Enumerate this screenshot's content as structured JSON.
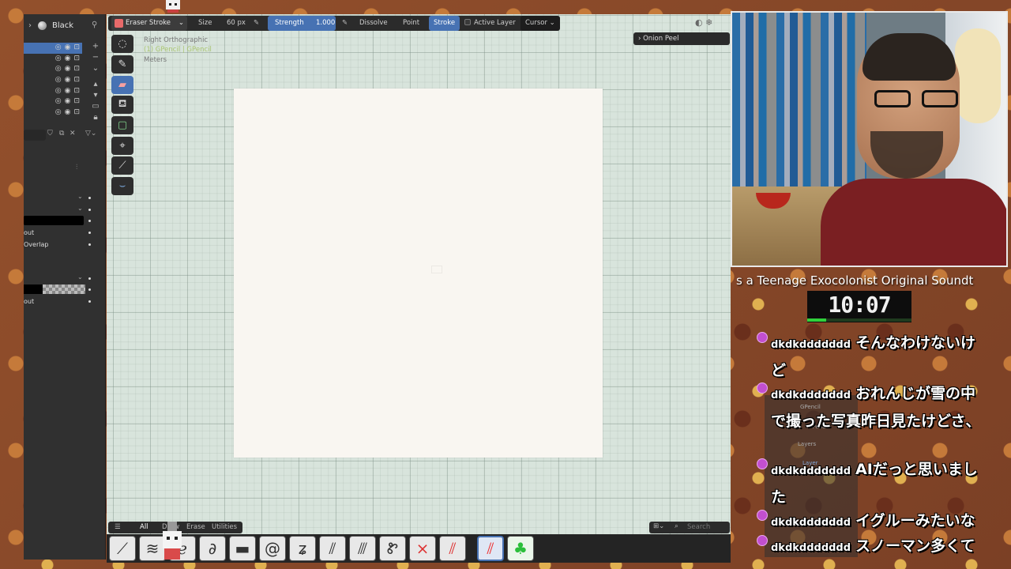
{
  "left_panel": {
    "title": "Black",
    "labels": {
      "out1": "out",
      "overlap": "Overlap",
      "out2": "out"
    },
    "layer_rows": 7
  },
  "viewport": {
    "view_name": "Right Orthographic",
    "object_name": "(1) GPencil | GPencil",
    "units": "Meters"
  },
  "toolbar": {
    "tool_name": "Eraser Stroke",
    "size_label": "Size",
    "size_value": "60 px",
    "strength_label": "Strength",
    "strength_value": "1.000",
    "dissolve": "Dissolve",
    "point": "Point",
    "stroke": "Stroke",
    "active_layer": "Active Layer",
    "cursor": "Cursor"
  },
  "onion_peel": "Onion Peel",
  "shelf": {
    "tabs": {
      "all": "All",
      "draw": "Draw",
      "erase": "Erase",
      "utilities": "Utilities"
    },
    "search_placeholder": "Search"
  },
  "ghost_panel": {
    "gpencil1": "GPencil",
    "gpencil2": "GPencil",
    "layers": "Layers",
    "layer": "Layer"
  },
  "overlay": {
    "song_ticker": "s a Teenage Exocolonist Original Soundt",
    "timer": "10:07",
    "timer_progress": 0.18,
    "accent_green": "#2fd13b"
  },
  "chat": [
    {
      "user": "dkdkddddddd",
      "message": "そんなわけないけど"
    },
    {
      "user": "dkdkddddddd",
      "message": "おれんじが雪の中で撮った写真昨日見たけどさ、"
    },
    {
      "user": "dkdkddddddd",
      "message": "AIだっと思いました"
    },
    {
      "user": "dkdkddddddd",
      "message": "イグルーみたいな"
    },
    {
      "user": "dkdkddddddd",
      "message": "スノーマン多くて"
    }
  ],
  "colors": {
    "accent_blue": "#4772b3",
    "panel": "#303030",
    "chat_badge": "#c24fcf"
  }
}
